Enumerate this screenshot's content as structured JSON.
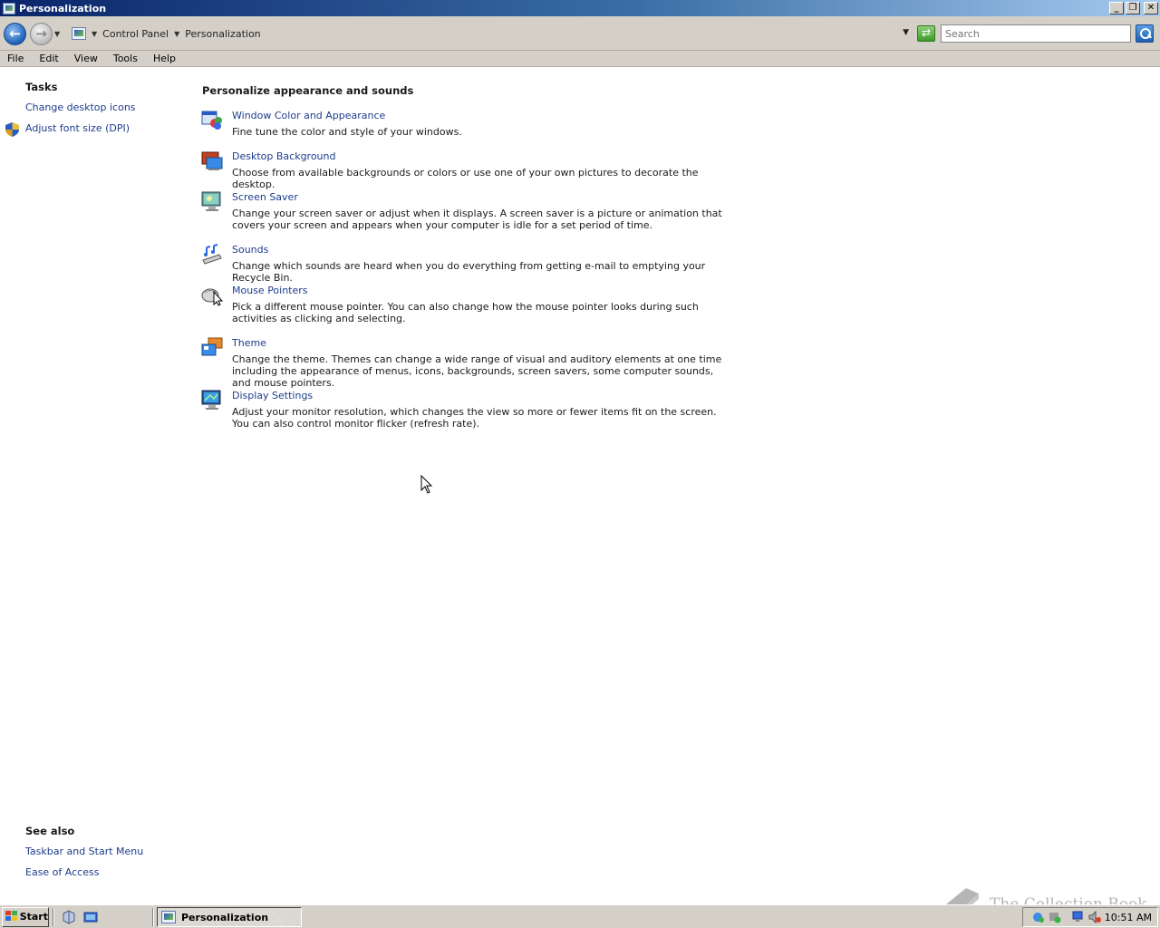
{
  "window": {
    "title": "Personalization",
    "minimize": "_",
    "maximize": "❐",
    "close": "✕"
  },
  "address": {
    "crumbs": [
      "Control Panel",
      "Personalization"
    ],
    "search_placeholder": "Search"
  },
  "menu": [
    "File",
    "Edit",
    "View",
    "Tools",
    "Help"
  ],
  "left_pane": {
    "tasks_heading": "Tasks",
    "tasks": [
      "Change desktop icons",
      "Adjust font size (DPI)"
    ],
    "see_also_heading": "See also",
    "see_also": [
      "Taskbar and Start Menu",
      "Ease of Access"
    ]
  },
  "main": {
    "heading": "Personalize appearance and sounds",
    "items": [
      {
        "title": "Window Color and Appearance",
        "desc": "Fine tune the color and style of your windows.",
        "icon": "window-color-icon"
      },
      {
        "title": "Desktop Background",
        "desc": "Choose from available backgrounds or colors or use one of your own pictures to decorate the desktop.",
        "icon": "desktop-background-icon"
      },
      {
        "title": "Screen Saver",
        "desc": "Change your screen saver or adjust when it displays. A screen saver is a picture or animation that covers your screen and appears when your computer is idle for a set period of time.",
        "icon": "screen-saver-icon"
      },
      {
        "title": "Sounds",
        "desc": "Change which sounds are heard when you do everything from getting e-mail to emptying your Recycle Bin.",
        "icon": "sounds-icon"
      },
      {
        "title": "Mouse Pointers",
        "desc": "Pick a different mouse pointer. You can also change how the mouse pointer looks during such activities as clicking and selecting.",
        "icon": "mouse-pointers-icon"
      },
      {
        "title": "Theme",
        "desc": "Change the theme. Themes can change a wide range of visual and auditory elements at one time including the appearance of menus, icons, backgrounds, screen savers, some computer sounds, and mouse pointers.",
        "icon": "theme-icon"
      },
      {
        "title": "Display Settings",
        "desc": "Adjust your monitor resolution, which changes the view so more or fewer items fit on the screen. You can also control monitor flicker (refresh rate).",
        "icon": "display-settings-icon"
      }
    ]
  },
  "taskbar": {
    "start_label": "Start",
    "active_task": "Personalization",
    "clock": "10:51 AM"
  },
  "watermark": {
    "text": "The Collection Book"
  }
}
